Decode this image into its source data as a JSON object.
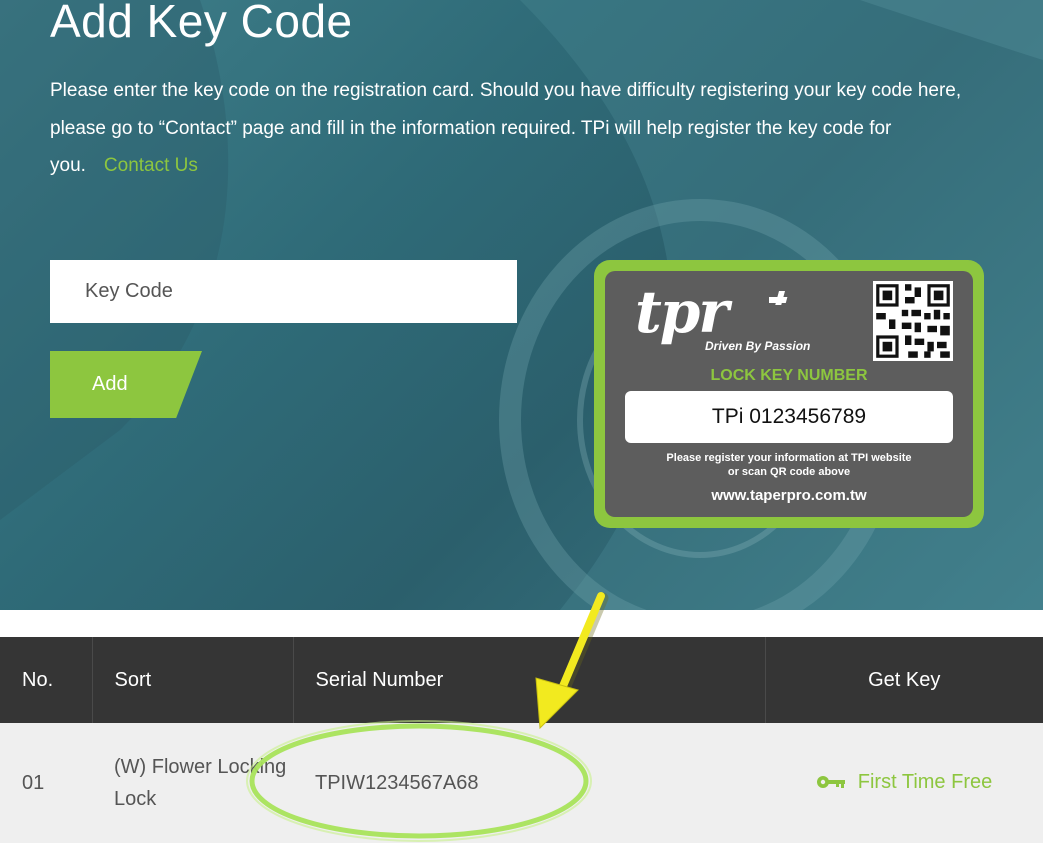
{
  "header": {
    "title": "Add Key Code",
    "description": "Please enter the key code on the registration card. Should you have difficulty registering your key code here, please go to “Contact” page and fill in the information required. TPi will help register the key code for you.",
    "contact_link": "Contact Us"
  },
  "form": {
    "key_code_placeholder": "Key Code",
    "add_label": "Add"
  },
  "card": {
    "logo_text": "tpr",
    "tagline": "Driven By Passion",
    "label": "LOCK KEY NUMBER",
    "number": "TPi 0123456789",
    "note_line1": "Please register your information at TPI website",
    "note_line2": "or scan QR code above",
    "url": "www.taperpro.com.tw"
  },
  "table": {
    "headers": [
      "No.",
      "Sort",
      "Serial Number",
      "Get Key"
    ],
    "rows": [
      {
        "no": "01",
        "sort": "(W) Flower Locking Lock",
        "serial": "TPIW1234567A68",
        "get_key": "First Time Free"
      }
    ]
  },
  "colors": {
    "accent": "#8dc63f",
    "table_header": "#353535",
    "table_row": "#efefef",
    "annotation_arrow": "#f2ea1f"
  }
}
